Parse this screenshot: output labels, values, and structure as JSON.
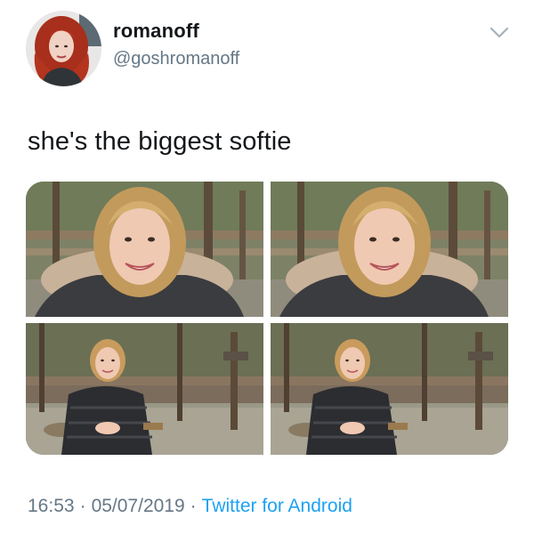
{
  "user": {
    "display_name": "romanoff",
    "handle": "@goshromanoff"
  },
  "tweet": {
    "text": "she's the biggest softie"
  },
  "meta": {
    "time": "16:53",
    "separator": "·",
    "date": "05/07/2019",
    "source": "Twitter for Android"
  },
  "media": {
    "count": 4
  },
  "colors": {
    "name_text": "#14171a",
    "secondary_text": "#657786",
    "link": "#1da1f2",
    "avatar_hair": "#b3341f"
  },
  "icons": {
    "more_menu": "chevron-down-icon"
  }
}
